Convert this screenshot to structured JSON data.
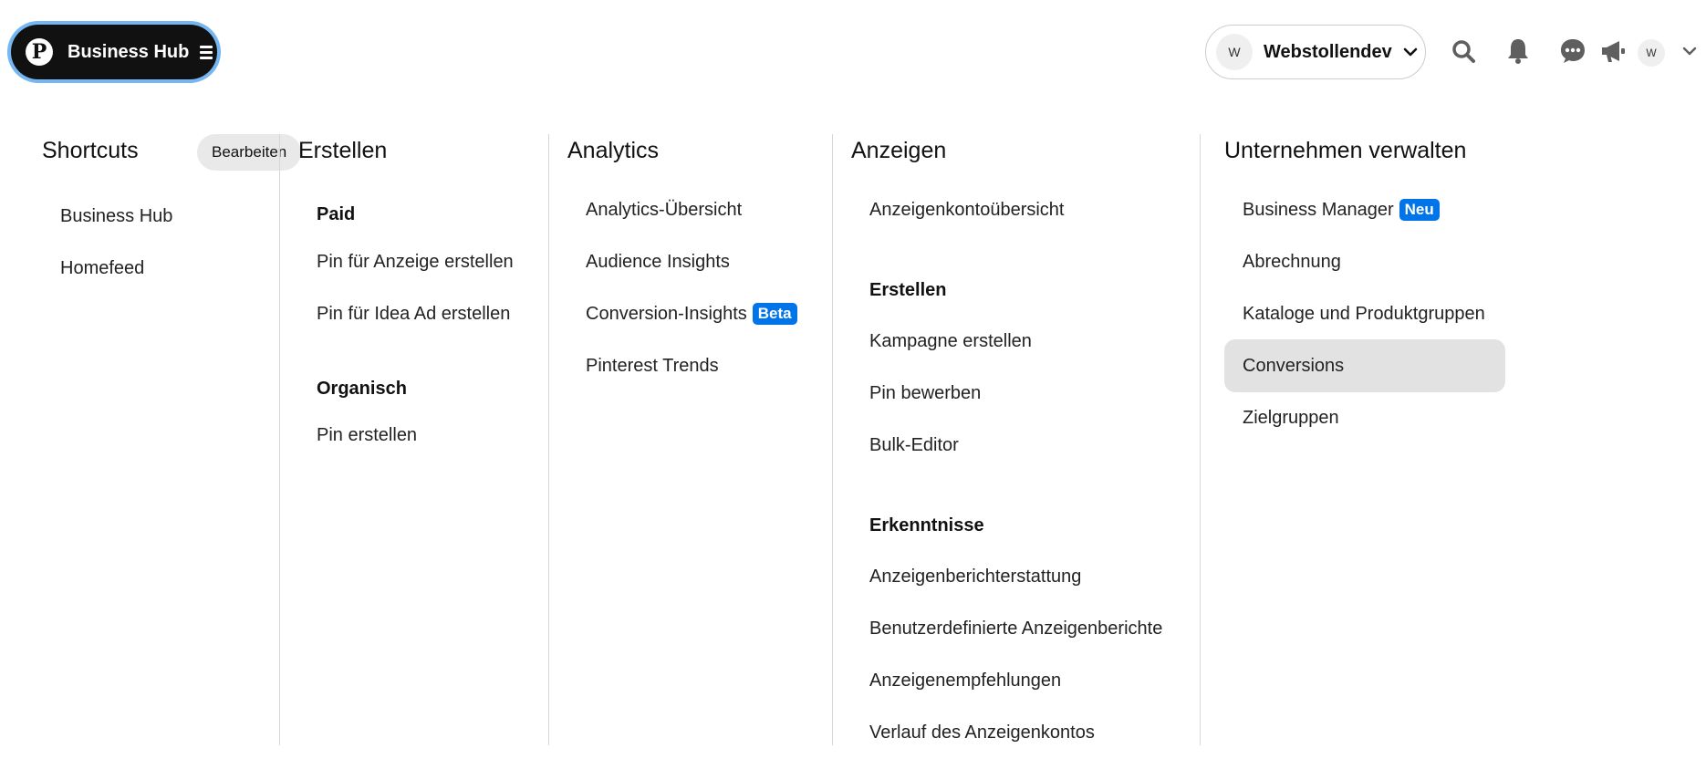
{
  "header": {
    "hub_label": "Business Hub",
    "account_initial": "W",
    "account_name": "Webstollendev",
    "profile_initial": "W"
  },
  "shortcuts": {
    "title": "Shortcuts",
    "edit_label": "Bearbeiten",
    "items": [
      "Business Hub",
      "Homefeed"
    ]
  },
  "erstellen": {
    "title": "Erstellen",
    "paid_heading": "Paid",
    "paid_items": [
      "Pin für Anzeige erstellen",
      "Pin für Idea Ad erstellen"
    ],
    "organic_heading": "Organisch",
    "organic_items": [
      "Pin erstellen"
    ]
  },
  "analytics": {
    "title": "Analytics",
    "items": [
      "Analytics-Übersicht",
      "Audience Insights",
      "Conversion-Insights",
      "Pinterest Trends"
    ],
    "beta_badge": "Beta"
  },
  "anzeigen": {
    "title": "Anzeigen",
    "overview": "Anzeigenkontoübersicht",
    "create_heading": "Erstellen",
    "create_items": [
      "Kampagne erstellen",
      "Pin bewerben",
      "Bulk-Editor"
    ],
    "insights_heading": "Erkenntnisse",
    "insights_items": [
      "Anzeigenberichterstattung",
      "Benutzerdefinierte Anzeigenberichte",
      "Anzeigenempfehlungen",
      "Verlauf des Anzeigenkontos"
    ]
  },
  "unternehmen": {
    "title": "Unternehmen verwalten",
    "items": [
      "Business Manager",
      "Abrechnung",
      "Kataloge und Produktgruppen",
      "Conversions",
      "Zielgruppen"
    ],
    "new_badge": "Neu",
    "highlighted": "Conversions"
  },
  "colors": {
    "accent_blue": "#0074e8",
    "focus_ring": "#74b7f2",
    "highlight": "#e2e2e2"
  }
}
